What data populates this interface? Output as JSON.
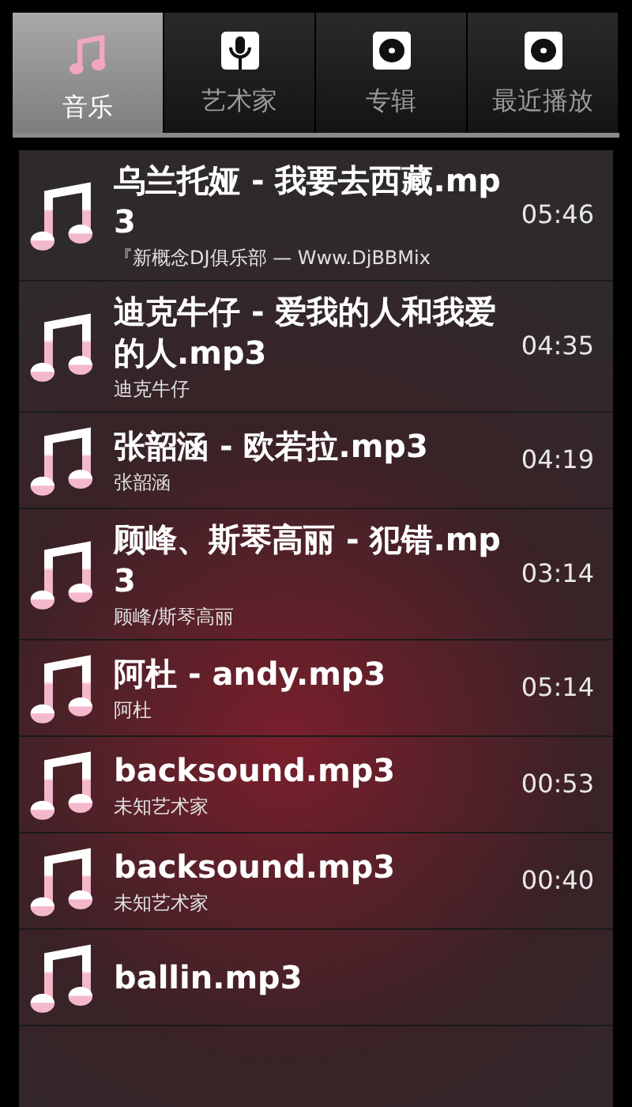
{
  "tabs": [
    {
      "label": "音乐",
      "kind": "note",
      "selected": true
    },
    {
      "label": "艺术家",
      "kind": "mic",
      "selected": false
    },
    {
      "label": "专辑",
      "kind": "disc",
      "selected": false
    },
    {
      "label": "最近播放",
      "kind": "disc",
      "selected": false
    }
  ],
  "songs": [
    {
      "title": "乌兰托娅 - 我要去西藏.mp3",
      "artist": "『新概念DJ俱乐部 — Www.DjBBMix",
      "duration": "05:46"
    },
    {
      "title": "迪克牛仔 - 爱我的人和我爱的人.mp3",
      "artist": "迪克牛仔",
      "duration": "04:35"
    },
    {
      "title": "张韶涵 - 欧若拉.mp3",
      "artist": "张韶涵",
      "duration": "04:19"
    },
    {
      "title": "顾峰、斯琴高丽 - 犯错.mp3",
      "artist": "顾峰/斯琴高丽",
      "duration": "03:14"
    },
    {
      "title": "阿杜 - andy.mp3",
      "artist": "阿杜",
      "duration": "05:14"
    },
    {
      "title": "backsound.mp3",
      "artist": "未知艺术家",
      "duration": "00:53"
    },
    {
      "title": "backsound.mp3",
      "artist": "未知艺术家",
      "duration": "00:40"
    },
    {
      "title": "ballin.mp3"
    }
  ]
}
